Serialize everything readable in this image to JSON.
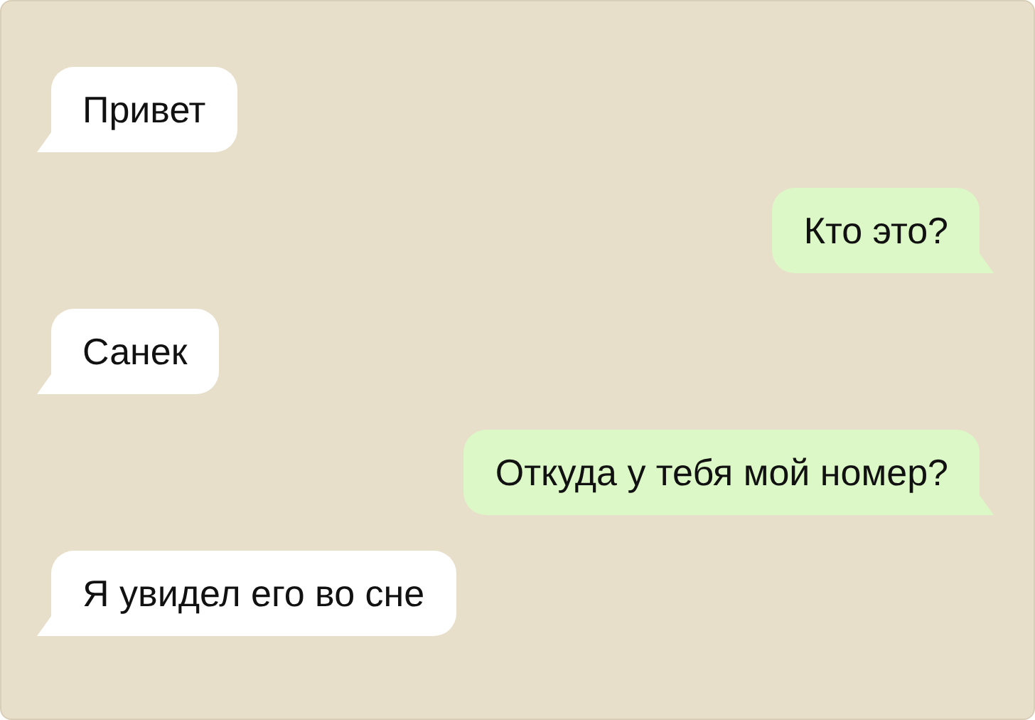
{
  "messages": [
    {
      "kind": "incoming",
      "text": "Привет"
    },
    {
      "kind": "outgoing",
      "text": "Кто это?"
    },
    {
      "kind": "incoming",
      "text": "Санек"
    },
    {
      "kind": "outgoing",
      "text": "Откуда у тебя мой номер?"
    },
    {
      "kind": "incoming",
      "text": "Я увидел его во сне"
    }
  ]
}
